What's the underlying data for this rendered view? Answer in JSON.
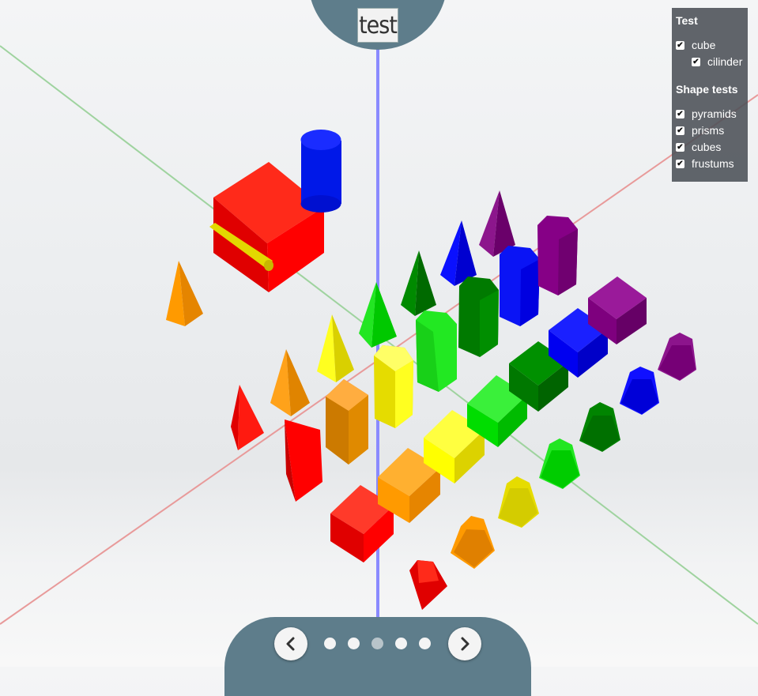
{
  "header": {
    "title": "test"
  },
  "panel": {
    "groups": [
      {
        "title": "Test",
        "items": [
          {
            "label": "cube",
            "checked": true,
            "indent": 0
          },
          {
            "label": "cilinder",
            "checked": true,
            "indent": 1
          }
        ]
      },
      {
        "title": "Shape tests",
        "items": [
          {
            "label": "pyramids",
            "checked": true,
            "indent": 0
          },
          {
            "label": "prisms",
            "checked": true,
            "indent": 0
          },
          {
            "label": "cubes",
            "checked": true,
            "indent": 0
          },
          {
            "label": "frustums",
            "checked": true,
            "indent": 0
          }
        ]
      }
    ]
  },
  "navigation": {
    "prev_icon": "chevron-left-icon",
    "next_icon": "chevron-right-icon",
    "pages": 5,
    "current_page": 3
  },
  "colors": {
    "red": "#ff0000",
    "orange": "#ff9900",
    "yellow": "#ffff00",
    "green": "#00ee00",
    "dark_green": "#008000",
    "blue": "#0000ff",
    "purple": "#880088",
    "axis_x": "#e88c8c",
    "axis_y": "#8fcf8f",
    "axis_z": "#8888ff",
    "bar": "#5e7d8b"
  }
}
